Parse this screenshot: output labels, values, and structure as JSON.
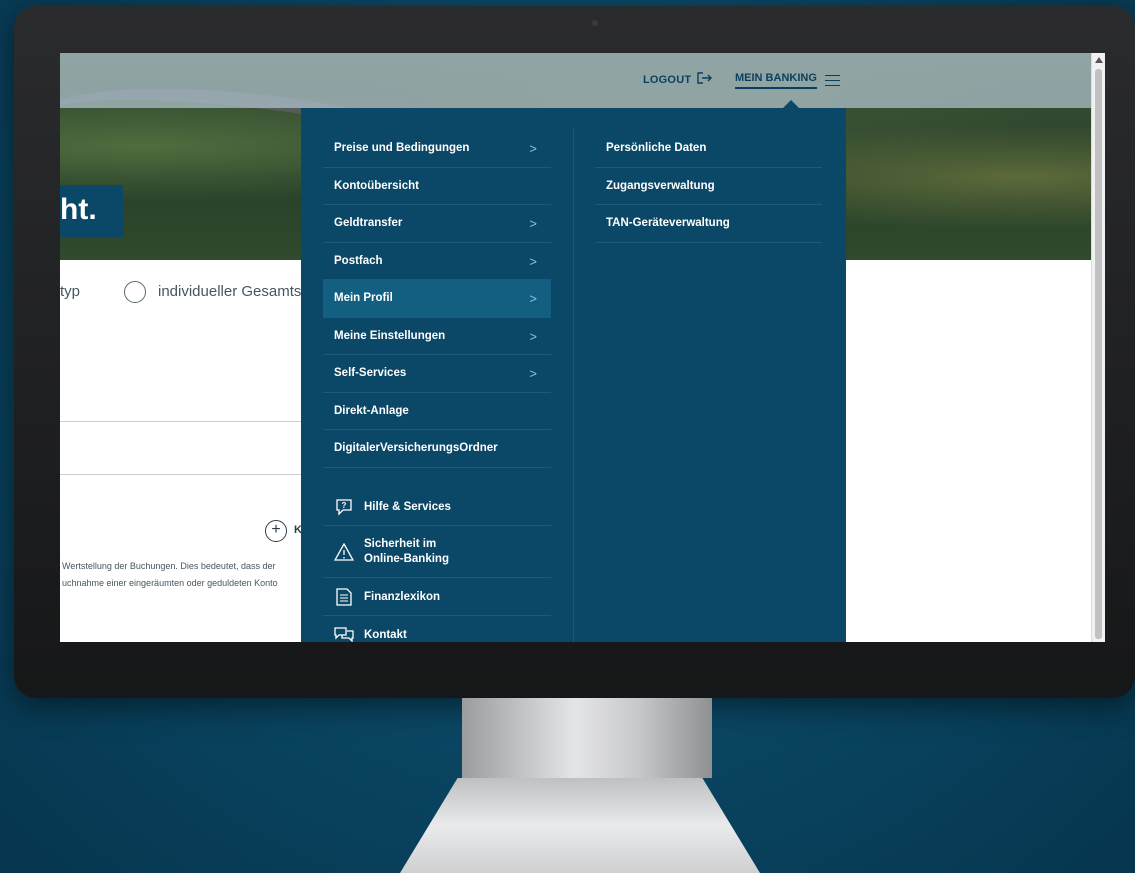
{
  "topbar": {
    "logout_label": "LOGOUT",
    "mein_banking_label": "MEIN BANKING"
  },
  "hero": {
    "headline": "ht."
  },
  "page": {
    "filter_typ_label": "typ",
    "filter_individual_label": "individueller Gesamtsa",
    "add_label": "K",
    "note_line1": "Wertstellung der Buchungen. Dies bedeutet, dass der",
    "note_line2": "uchnahme einer eingeräumten oder geduldeten Konto"
  },
  "menu": {
    "items": [
      {
        "label": "Preise und Bedingungen",
        "has_submenu": true
      },
      {
        "label": "Kontoübersicht",
        "has_submenu": false
      },
      {
        "label": "Geldtransfer",
        "has_submenu": true
      },
      {
        "label": "Postfach",
        "has_submenu": true
      },
      {
        "label": "Mein Profil",
        "has_submenu": true,
        "active": true
      },
      {
        "label": "Meine Einstellungen",
        "has_submenu": true
      },
      {
        "label": "Self-Services",
        "has_submenu": true
      },
      {
        "label": "Direkt-Anlage",
        "has_submenu": false
      },
      {
        "label": "DigitalerVersicherungsOrdner",
        "has_submenu": false
      }
    ],
    "help": [
      {
        "label": "Hilfe & Services",
        "icon": "help-chat-icon"
      },
      {
        "label_line1": "Sicherheit im",
        "label_line2": "Online-Banking",
        "icon": "warning-icon"
      },
      {
        "label": "Finanzlexikon",
        "icon": "document-icon"
      },
      {
        "label": "Kontakt",
        "icon": "contact-icon"
      }
    ],
    "submenu": [
      {
        "label": "Persönliche Daten"
      },
      {
        "label": "Zugangsverwaltung"
      },
      {
        "label": "TAN-Geräteverwaltung"
      }
    ]
  },
  "colors": {
    "menu_bg": "#0b4766",
    "menu_active": "#125f82",
    "accent_text": "#0a3f5e"
  }
}
